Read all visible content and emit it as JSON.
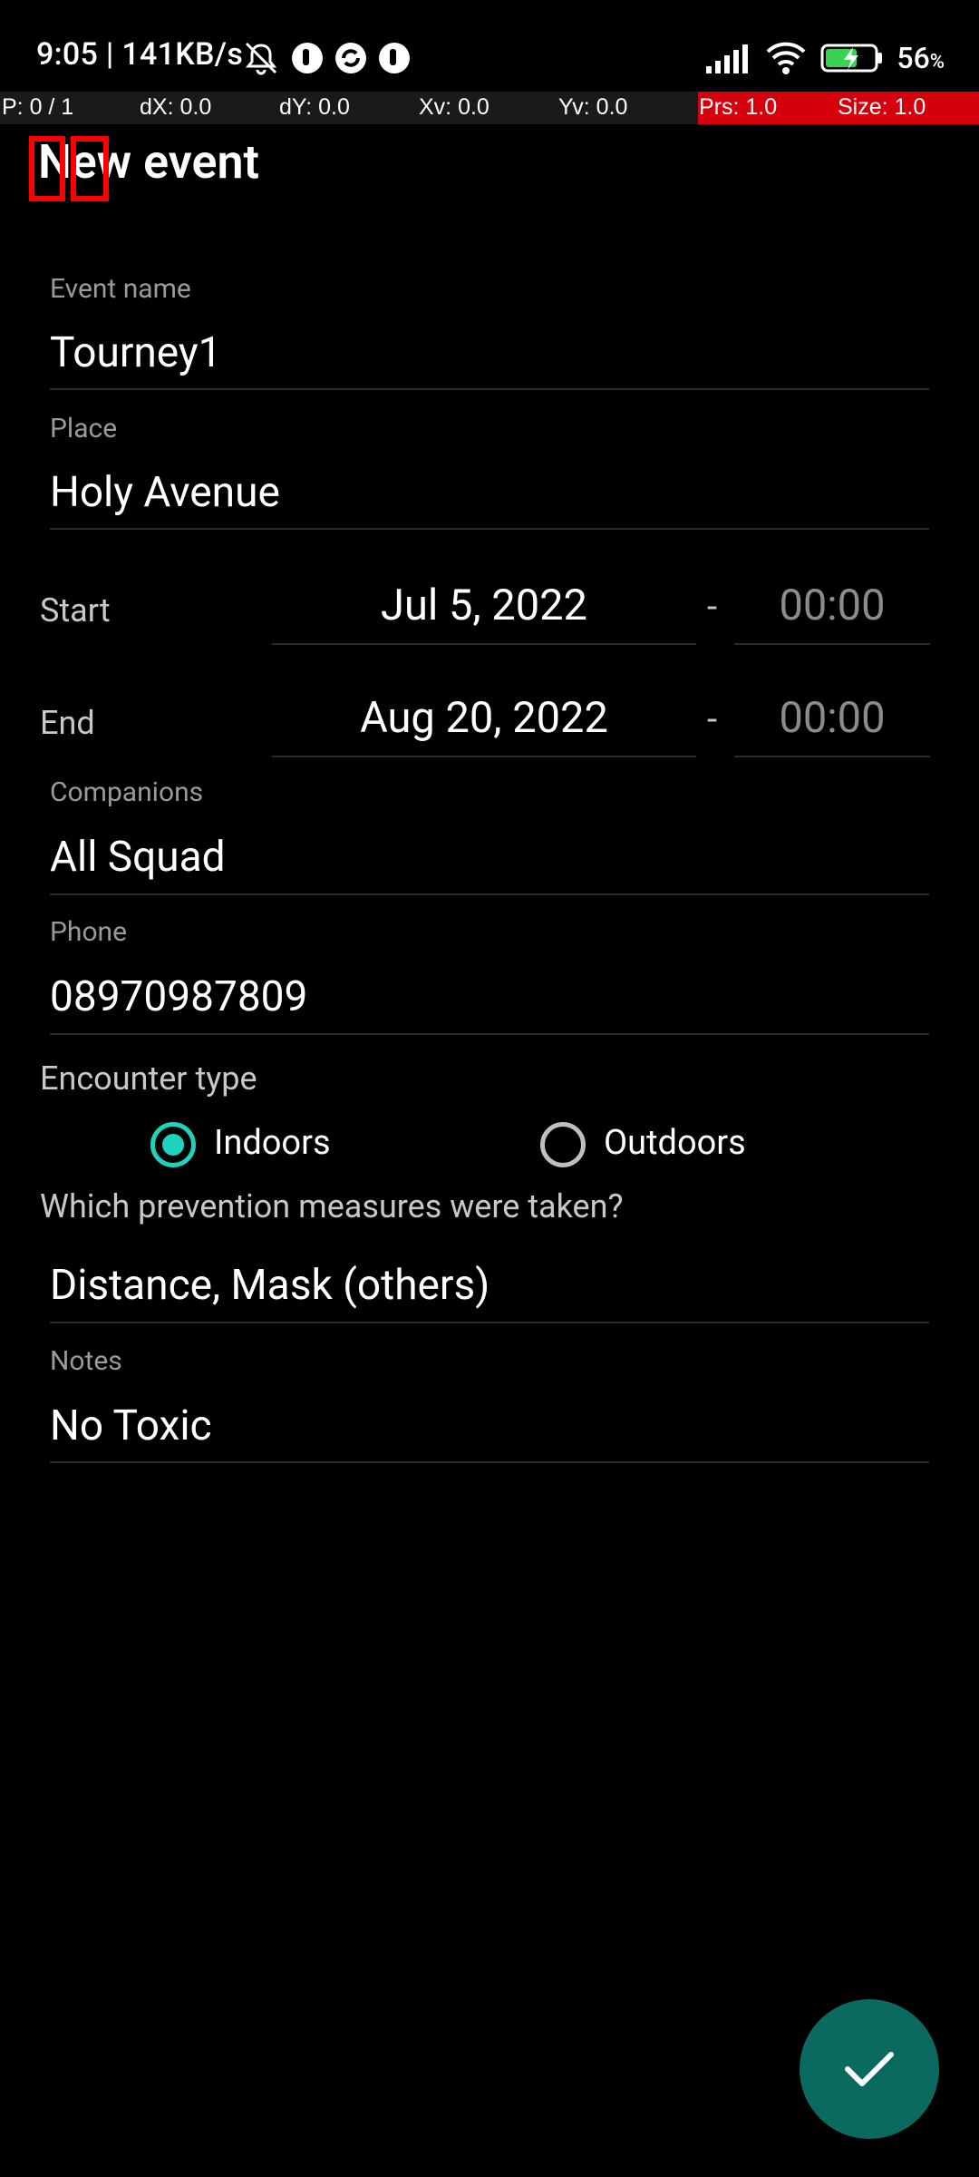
{
  "status_bar": {
    "time_speed": "9:05 | 141KB/s",
    "battery_pct": "56",
    "battery_unit": "%"
  },
  "overlay": {
    "p": "P: 0 / 1",
    "dx": "dX: 0.0",
    "dy": "dY: 0.0",
    "xv": "Xv: 0.0",
    "yv": "Yv: 0.0",
    "prs": "Prs: 1.0",
    "size": "Size: 1.0"
  },
  "header": {
    "title": "New event"
  },
  "form": {
    "event_name": {
      "label": "Event name",
      "value": "Tourney1"
    },
    "place": {
      "label": "Place",
      "value": "Holy Avenue"
    },
    "start": {
      "label": "Start",
      "date": "Jul 5, 2022",
      "dash": "-",
      "time": "00:00"
    },
    "end": {
      "label": "End",
      "date": "Aug 20, 2022",
      "dash": "-",
      "time": "00:00"
    },
    "companions": {
      "label": "Companions",
      "value": "All Squad"
    },
    "phone": {
      "label": "Phone",
      "value": "08970987809"
    },
    "encounter": {
      "label": "Encounter type",
      "options": [
        {
          "label": "Indoors",
          "selected": true
        },
        {
          "label": "Outdoors",
          "selected": false
        }
      ]
    },
    "prevention": {
      "label": "Which prevention measures were taken?",
      "value": "Distance, Mask (others)"
    },
    "notes": {
      "label": "Notes",
      "value": "No Toxic"
    }
  },
  "colors": {
    "accent": "#1dd3c0",
    "fab": "#0a6a5f",
    "overlay_red": "#d5000b"
  },
  "icons": {
    "fab": "check-icon"
  }
}
